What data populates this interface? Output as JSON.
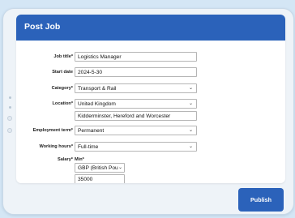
{
  "header": {
    "title": "Post Job"
  },
  "form": {
    "job_title": {
      "label": "Job title*",
      "value": "Logistics Manager"
    },
    "start_date": {
      "label": "Start date",
      "value": "2024-5-30"
    },
    "category": {
      "label": "Category*",
      "value": "Transport & Rail"
    },
    "location": {
      "label": "Location*",
      "country": "United Kingdom",
      "region": "Kidderminster, Hereford and Worcester"
    },
    "employment_term": {
      "label": "Employment term*",
      "value": "Permanent"
    },
    "working_hours": {
      "label": "Working hours*",
      "value": "Full-time"
    },
    "salary": {
      "label": "Salary*",
      "min_label": "Min*",
      "currency": "GBP (British Pou",
      "amount": "35000"
    }
  },
  "actions": {
    "publish_label": "Publish"
  },
  "icons": {
    "dropdown": "chevron-down-icon"
  }
}
